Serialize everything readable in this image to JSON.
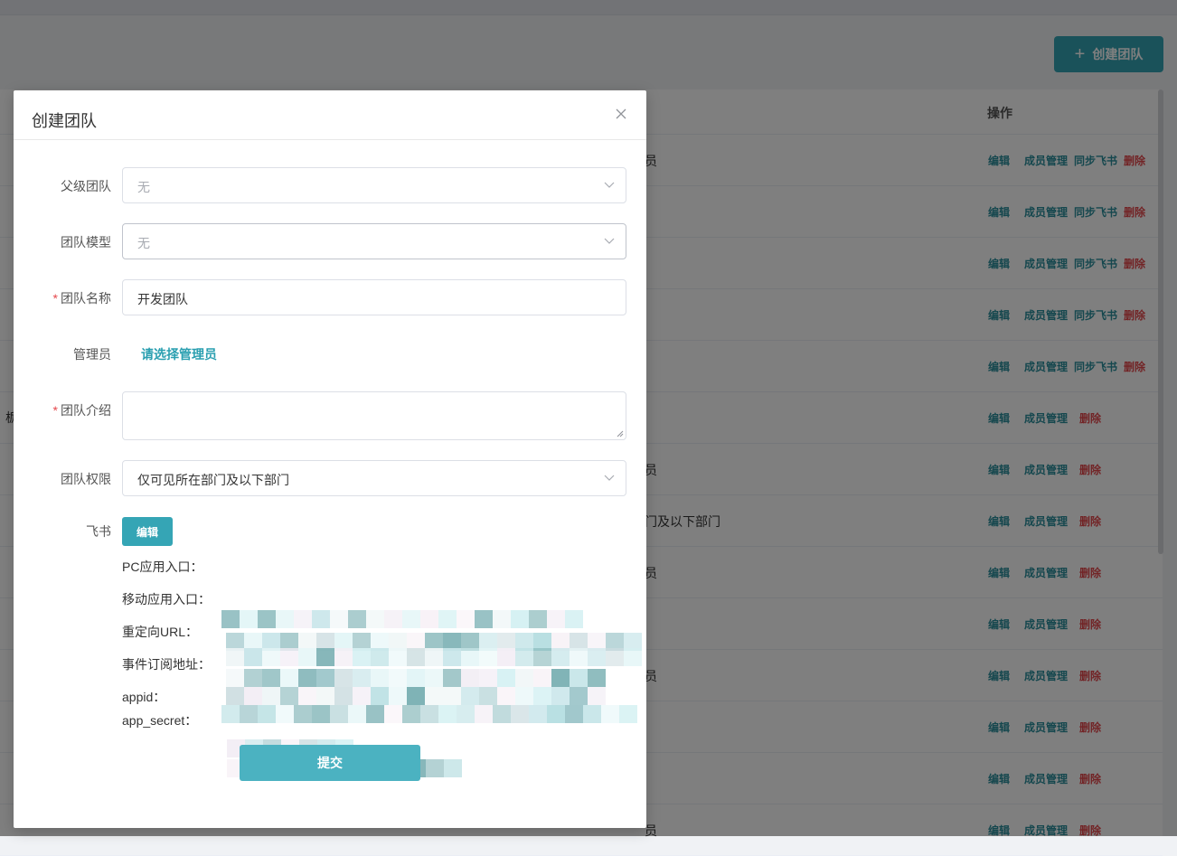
{
  "background": {
    "create_button_label": "创建团队",
    "table_header_actions": "操作",
    "side_char": "栃",
    "rows": [
      {
        "text": "员",
        "actions": [
          "编辑",
          "成员管理",
          "同步飞书",
          "删除"
        ]
      },
      {
        "text": "",
        "actions": [
          "编辑",
          "成员管理",
          "同步飞书",
          "删除"
        ]
      },
      {
        "text": "",
        "actions": [
          "编辑",
          "成员管理",
          "同步飞书",
          "删除"
        ]
      },
      {
        "text": "",
        "actions": [
          "编辑",
          "成员管理",
          "同步飞书",
          "删除"
        ]
      },
      {
        "text": "",
        "actions": [
          "编辑",
          "成员管理",
          "同步飞书",
          "删除"
        ]
      },
      {
        "text": "",
        "actions": [
          "编辑",
          "成员管理",
          "删除"
        ]
      },
      {
        "text": "员",
        "actions": [
          "编辑",
          "成员管理",
          "删除"
        ]
      },
      {
        "text": "门及以下部门",
        "actions": [
          "编辑",
          "成员管理",
          "删除"
        ]
      },
      {
        "text": "员",
        "actions": [
          "编辑",
          "成员管理",
          "删除"
        ]
      },
      {
        "text": "",
        "actions": [
          "编辑",
          "成员管理",
          "删除"
        ]
      },
      {
        "text": "员",
        "actions": [
          "编辑",
          "成员管理",
          "删除"
        ]
      },
      {
        "text": "",
        "actions": [
          "编辑",
          "成员管理",
          "删除"
        ]
      },
      {
        "text": "",
        "actions": [
          "编辑",
          "成员管理",
          "删除"
        ]
      },
      {
        "text": "员",
        "actions": [
          "编辑",
          "成员管理",
          "删除"
        ]
      }
    ]
  },
  "modal": {
    "title": "创建团队",
    "close_icon": "close-icon",
    "fields": {
      "parent_team": {
        "label": "父级团队",
        "value": "无"
      },
      "team_model": {
        "label": "团队模型",
        "value": "无"
      },
      "team_name": {
        "label": "团队名称",
        "value": "开发团队",
        "required_mark": "*"
      },
      "admin": {
        "label": "管理员",
        "link": "请选择管理员"
      },
      "team_intro": {
        "label": "团队介绍",
        "value": "",
        "required_mark": "*"
      },
      "team_permission": {
        "label": "团队权限",
        "value": "仅可见所在部门及以下部门"
      },
      "feishu": {
        "label": "飞书",
        "edit_label": "编辑"
      }
    },
    "feishu_info": {
      "pc_entry": "PC应用入口：",
      "mobile_entry": "移动应用入口：",
      "redirect_url": "重定向URL：",
      "event_url": "事件订阅地址：",
      "appid": "appid：",
      "app_secret": "app_secret："
    },
    "submit_label": "提交"
  }
}
